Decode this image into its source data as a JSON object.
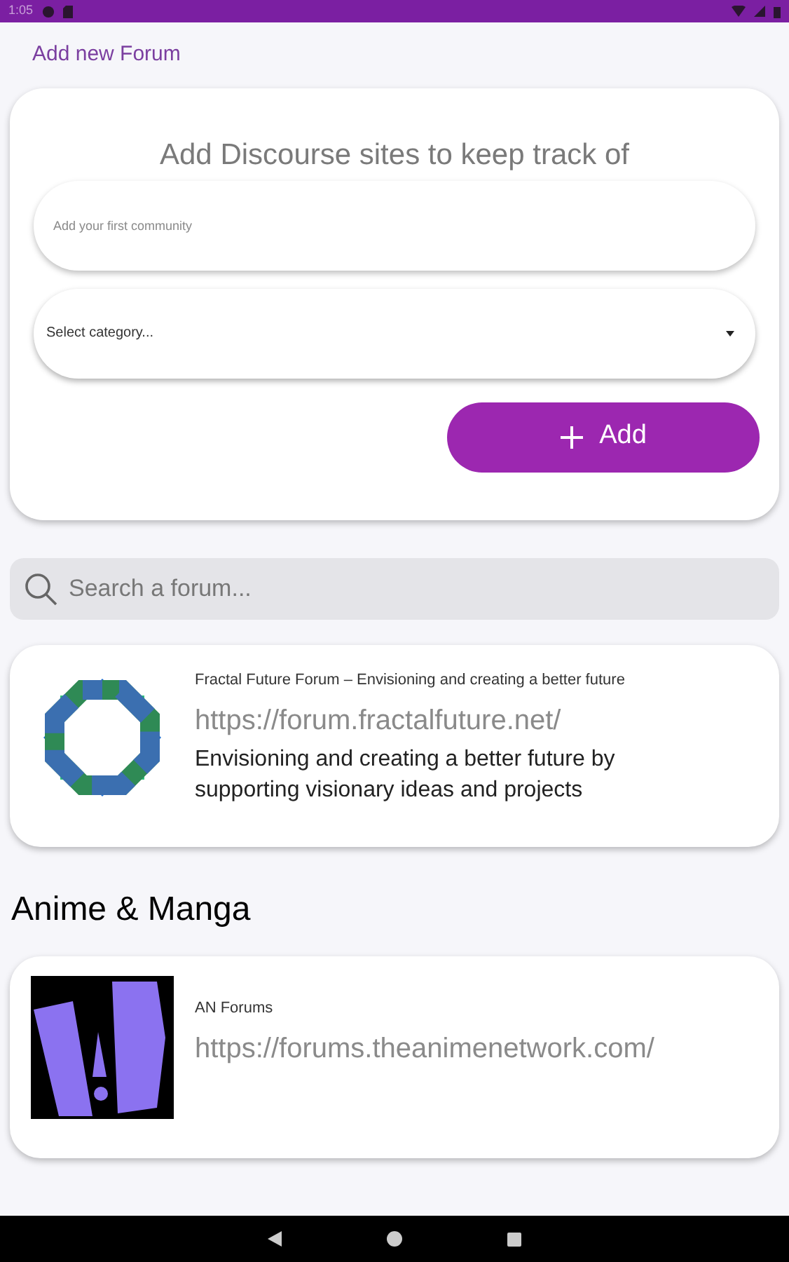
{
  "status_bar": {
    "time": "1:05"
  },
  "page_title": "Add new Forum",
  "add_card": {
    "heading": "Add Discourse sites to keep track of",
    "community_field": {
      "placeholder": "Add your first community"
    },
    "category_select": {
      "value": "Select category..."
    },
    "add_button": {
      "label": "Add"
    }
  },
  "search": {
    "placeholder": "Search a forum..."
  },
  "sections": [
    {
      "forums": [
        {
          "kind": "octagon",
          "title": "Fractal Future Forum – Envisioning and creating a better future",
          "url": "https://forum.fractalfuture.net/",
          "description": "Envisioning and creating a better future by supporting visionary ideas and projects"
        }
      ]
    },
    {
      "heading": "Anime & Manga",
      "forums": [
        {
          "kind": "mark",
          "title": "AN Forums",
          "url": "https://forums.theanimenetwork.com/"
        }
      ]
    }
  ]
}
